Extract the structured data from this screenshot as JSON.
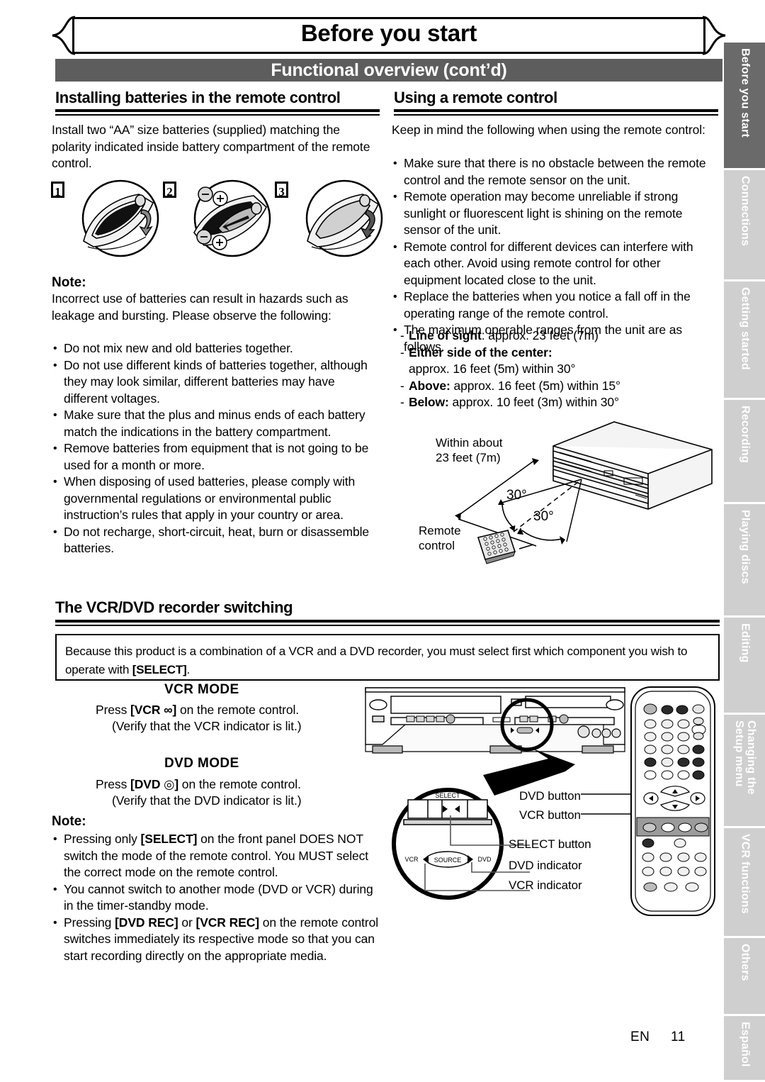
{
  "header": {
    "chapter_title": "Before you start",
    "section_title": "Functional overview (cont’d)"
  },
  "side_tabs": [
    {
      "label": "Before you start",
      "active": true
    },
    {
      "label": "Connections",
      "active": false
    },
    {
      "label": "Getting started",
      "active": false
    },
    {
      "label": "Recording",
      "active": false
    },
    {
      "label": "Playing discs",
      "active": false
    },
    {
      "label": "Editing",
      "active": false
    },
    {
      "label": "Changing the\nSetup menu",
      "active": false
    },
    {
      "label": "VCR functions",
      "active": false
    },
    {
      "label": "Others",
      "active": false
    },
    {
      "label": "Español",
      "active": false
    }
  ],
  "left_column": {
    "heading": "Installing batteries in the remote control",
    "intro": "Install two “AA” size batteries (supplied) matching the polarity indicated inside battery compartment of the remote control.",
    "figure_steps": [
      "1",
      "2",
      "3"
    ],
    "note_label": "Note:",
    "note_intro": "Incorrect use of batteries can result in hazards such as leakage and bursting. Please observe the following:",
    "note_bullets": [
      "Do not mix new and old batteries together.",
      "Do not use different kinds of batteries together, although they may look similar, different batteries may have different voltages.",
      "Make sure that the plus and minus ends of each battery match the indications in the battery compartment.",
      "Remove batteries from equipment that is not going to be used for a month or more.",
      "When disposing of used batteries, please comply with governmental regulations or environmental public instruction’s rules that apply in your country or area.",
      "Do not recharge, short-circuit, heat, burn or disassemble batteries."
    ]
  },
  "right_column": {
    "heading": "Using a remote control",
    "intro": "Keep in mind the following when using the remote control:",
    "bullets": [
      "Make sure that there is no obstacle between the remote control and the remote sensor on the unit.",
      "Remote operation may become unreliable if strong sunlight or fluorescent light is shining on the remote sensor of the unit.",
      "Remote control for different devices can interfere with each other. Avoid using remote control for other equipment located close to the unit.",
      "Replace the batteries when you notice a fall off in the operating range of the remote control.",
      "The maximum operable ranges from the unit are as follows."
    ],
    "ranges": [
      {
        "label": "Line of sight",
        "sep": ":",
        "value": " approx. 23 feet (7m)"
      },
      {
        "label": "Either side of the center:",
        "sep": "",
        "value": ""
      },
      {
        "label": "",
        "sep": "",
        "value": "approx. 16 feet (5m) within 30°"
      },
      {
        "label": "Above:",
        "sep": "",
        "value": " approx. 16 feet (5m) within 15°"
      },
      {
        "label": "Below:",
        "sep": "",
        "value": " approx. 10 feet (3m) within 30°"
      }
    ],
    "diagram": {
      "distance_label": "Within about\n23 feet (7m)",
      "remote_label": "Remote\ncontrol",
      "angle_upper": "30°",
      "angle_lower": "30°"
    }
  },
  "switching_section": {
    "heading": "The VCR/DVD recorder switching",
    "box_text_before": "Because this product is a combination of a VCR and a DVD recorder, you must select first which component you wish to operate with ",
    "box_text_key": "[SELECT]",
    "box_text_after": ".",
    "vcr_mode": {
      "title": "VCR MODE",
      "line1_pre": "Press ",
      "line1_key": "[VCR ",
      "line1_icon": "∞",
      "line1_key_end": "]",
      "line1_post": " on the remote control.",
      "line2": "(Verify that the VCR indicator is lit.)"
    },
    "dvd_mode": {
      "title": "DVD MODE",
      "line1_pre": "Press ",
      "line1_key": "[DVD ",
      "line1_icon": "◎",
      "line1_key_end": "]",
      "line1_post": " on the remote control.",
      "line2": "(Verify that the DVD indicator is lit.)"
    },
    "note_label": "Note:",
    "note_bullets": [
      {
        "pre": "Pressing only ",
        "key": "[SELECT]",
        "post": " on the front panel DOES NOT switch the mode of the remote control. You MUST select the correct mode on the remote control."
      },
      {
        "pre": "",
        "key": "",
        "post": "You cannot switch to another mode (DVD or VCR) during in the timer-standby mode."
      },
      {
        "pre": "Pressing ",
        "key": "[DVD REC]",
        "mid": " or ",
        "key2": "[VCR REC]",
        "post": " on the remote control switches immediately its respective mode so that you can start recording directly on the appropriate media."
      }
    ],
    "callouts": {
      "dvd_button": "DVD button",
      "vcr_button": "VCR button",
      "select_button": "SELECT button",
      "dvd_indicator": "DVD indicator",
      "vcr_indicator": "VCR indicator"
    },
    "zoom_detail": {
      "select_label": "SELECT",
      "vcr_label": "VCR",
      "source_label": "SOURCE",
      "dvd_label": "DVD"
    }
  },
  "footer": {
    "lang": "EN",
    "page": "11"
  }
}
